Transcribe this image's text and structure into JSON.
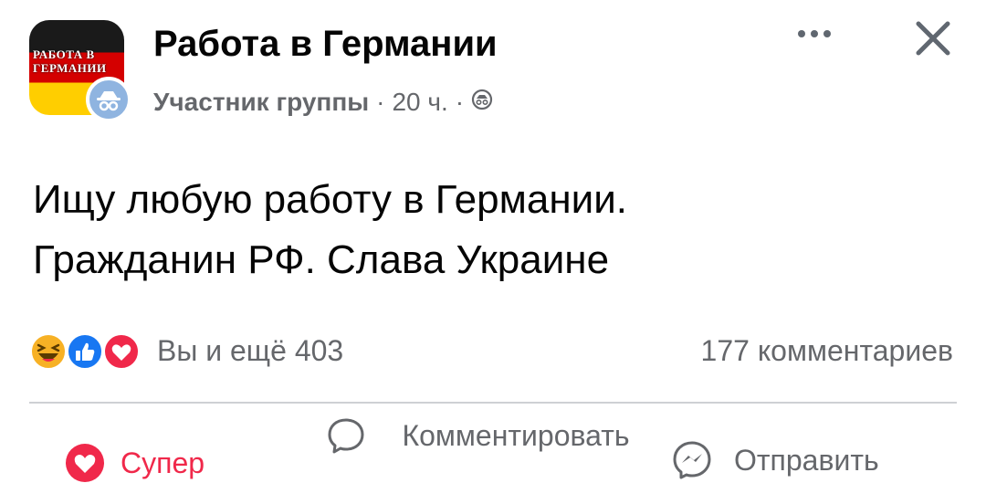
{
  "header": {
    "group_name": "Работа в Германии",
    "avatar_logo_text": "РАБОТА В ГЕРМАНИИ",
    "member_role": "Участник группы",
    "time": "20 ч.",
    "separator": "·",
    "privacy_icon": "anonymous-icon",
    "more_icon": "more-icon",
    "close_icon": "close-icon"
  },
  "post": {
    "lines": [
      "Ищу любую работу в Германии.",
      "Гражданин РФ. Слава Украине"
    ]
  },
  "reactions": {
    "icons": [
      "haha-icon",
      "like-icon",
      "care-icon"
    ],
    "summary": "Вы и ещё 403",
    "comments": "177 комментариев"
  },
  "actions": {
    "care_label": "Супер",
    "comment_label": "Комментировать",
    "send_label": "Отправить"
  },
  "colors": {
    "care": "#f0284a",
    "like": "#1877f2",
    "haha": "#f7b125",
    "muted": "#65676b",
    "divider": "#ced0d4"
  }
}
